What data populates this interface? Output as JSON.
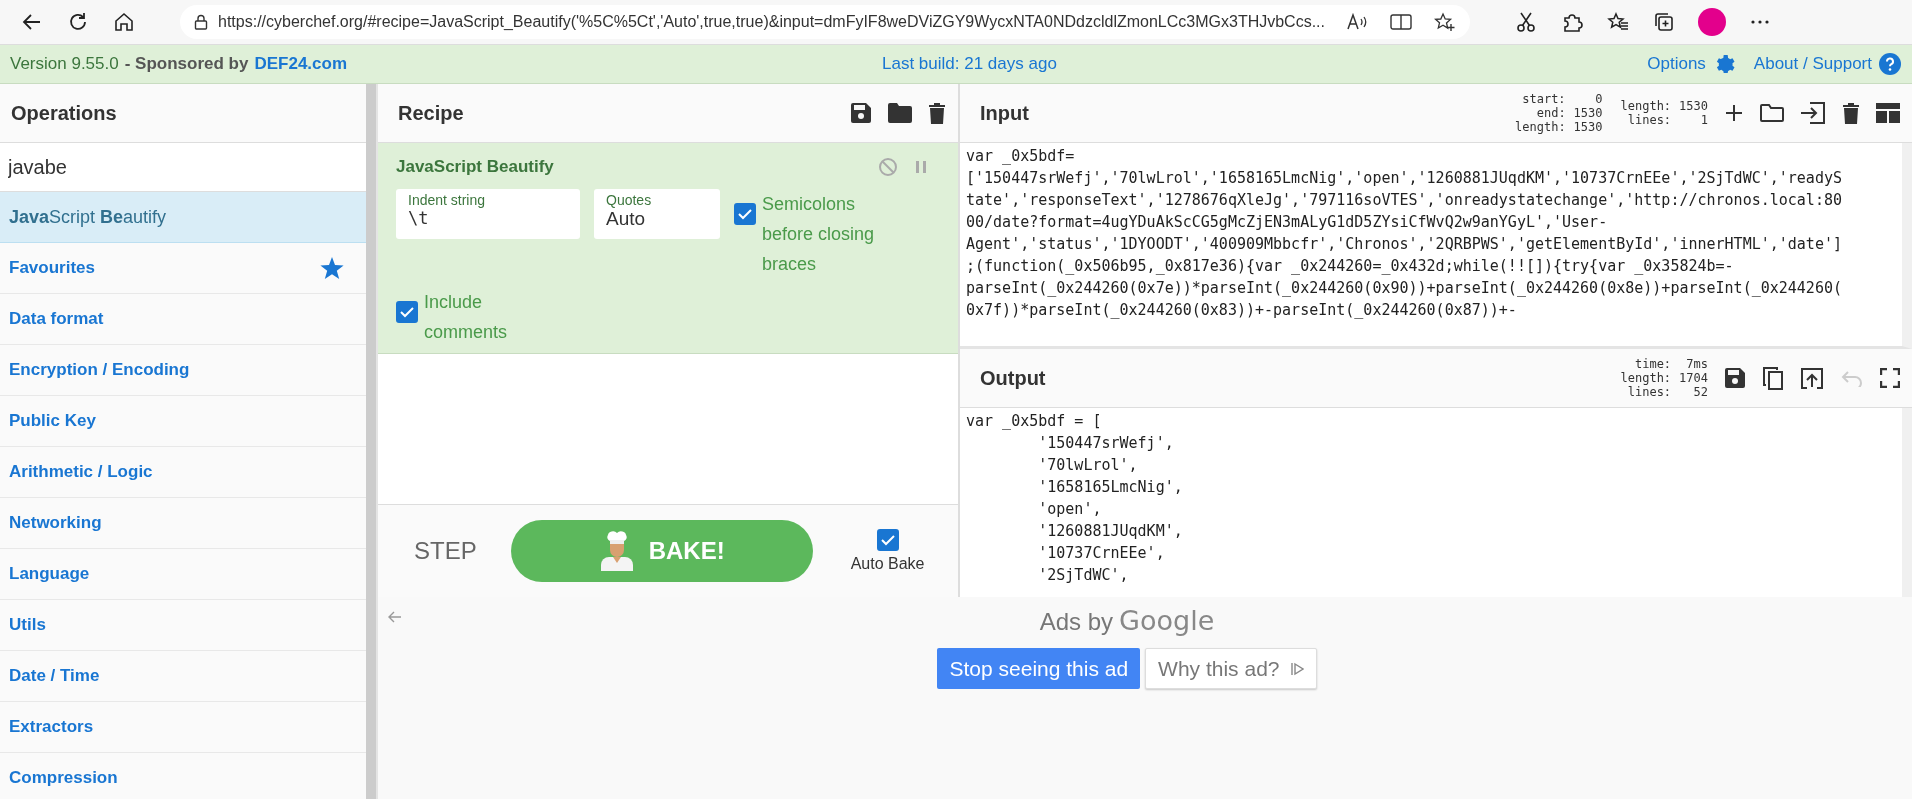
{
  "browser": {
    "url": "https://cyberchef.org/#recipe=JavaScript_Beautify('%5C%5Ct','Auto',true,true)&input=dmFyIF8weDViZGY9WycxNTA0NDdzcldlZmonLCc3MGx3THJvbCcs..."
  },
  "header": {
    "version": "Version 9.55.0",
    "sponsored": "- Sponsored by",
    "sponsor_link": "DEF24.com",
    "last_build": "Last build: 21 days ago",
    "options": "Options",
    "about": "About / Support"
  },
  "operations": {
    "title": "Operations",
    "search_value": "javabe",
    "results": [
      {
        "label": "**Java**Script **Be**autify"
      }
    ],
    "categories": [
      {
        "label": "Favourites",
        "kind": "favourites"
      },
      {
        "label": "Data format",
        "kind": "category"
      },
      {
        "label": "Encryption / Encoding",
        "kind": "category"
      },
      {
        "label": "Public Key",
        "kind": "category"
      },
      {
        "label": "Arithmetic / Logic",
        "kind": "category"
      },
      {
        "label": "Networking",
        "kind": "category"
      },
      {
        "label": "Language",
        "kind": "category"
      },
      {
        "label": "Utils",
        "kind": "category"
      },
      {
        "label": "Date / Time",
        "kind": "category"
      },
      {
        "label": "Extractors",
        "kind": "category"
      },
      {
        "label": "Compression",
        "kind": "category"
      }
    ]
  },
  "recipe": {
    "title": "Recipe",
    "operation": {
      "name": "JavaScript Beautify",
      "disabled": false,
      "paused": false,
      "fields": [
        {
          "label": "Indent string",
          "value": "\\t"
        },
        {
          "label": "Quotes",
          "value": "Auto"
        }
      ],
      "checkboxes": [
        {
          "label": "Semicolons before closing braces",
          "checked": true
        },
        {
          "label": "Include comments",
          "checked": true
        }
      ]
    },
    "step": "STEP",
    "bake": "BAKE!",
    "auto_bake": {
      "label": "Auto Bake",
      "checked": true
    }
  },
  "input": {
    "title": "Input",
    "stats": [
      [
        {
          "label": "start:",
          "value": "0"
        },
        {
          "label": "end:",
          "value": "1530"
        },
        {
          "label": "length:",
          "value": "1530"
        }
      ],
      [
        {
          "label": "length:",
          "value": "1530"
        },
        {
          "label": "lines:",
          "value": "1"
        }
      ]
    ],
    "lines": [
      "var _0x5bdf=",
      "['150447srWefj','70lwLrol','1658165LmcNig','open','1260881JUqdKM','10737CrnEEe','2SjTdWC','readyS",
      "tate','responseText','1278676qXleJg','797116soVTES','onreadystatechange','http://chronos.local:80",
      "00/date?format=4ugYDuAkScCG5gMcZjEN3mALyG1dD5ZYsiCfWvQ2w9anYGyL','User-",
      "Agent','status','1DYOODT','400909Mbbcfr','Chronos','2QRBPWS','getElementById','innerHTML','date']",
      ";(function(_0x506b95,_0x817e36){var _0x244260=_0x432d;while(!![]){try{var _0x35824b=-",
      "parseInt(_0x244260(0x7e))*parseInt(_0x244260(0x90))+parseInt(_0x244260(0x8e))+parseInt(_0x244260(",
      "0x7f))*parseInt(_0x244260(0x83))+-parseInt(_0x244260(0x87))+-"
    ]
  },
  "output": {
    "title": "Output",
    "undo_disabled": true,
    "stats": [
      [
        {
          "label": "time:",
          "value": "7ms"
        },
        {
          "label": "length:",
          "value": "1704"
        },
        {
          "label": "lines:",
          "value": "52"
        }
      ]
    ],
    "lines": [
      "var _0x5bdf = [",
      "\t'150447srWefj',",
      "\t'70lwLrol',",
      "\t'1658165LmcNig',",
      "\t'open',",
      "\t'1260881JUqdKM',",
      "\t'10737CrnEEe',",
      "\t'2SjTdWC',"
    ]
  },
  "ad": {
    "ads_by": "Ads by",
    "brand": "Google",
    "stop": "Stop seeing this ad",
    "why": "Why this ad?"
  }
}
